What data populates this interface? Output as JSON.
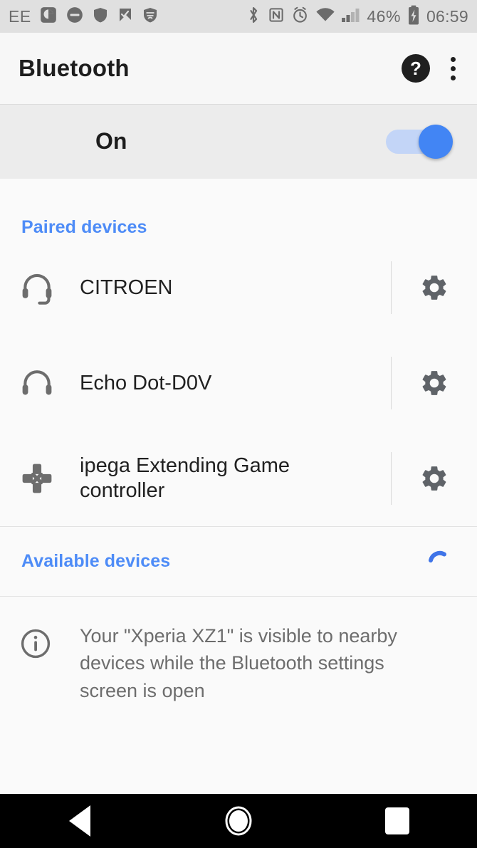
{
  "statusbar": {
    "carrier": "EE",
    "battery_percent": "46%",
    "clock": "06:59",
    "icons_left": [
      "sim-card-icon",
      "do-not-disturb-icon",
      "shield-icon",
      "check-flag-icon",
      "shield-waves-icon"
    ],
    "icons_right": [
      "bluetooth-icon",
      "nfc-icon",
      "alarm-icon",
      "wifi-icon",
      "cellular-signal-icon",
      "battery-charging-icon"
    ],
    "signal_bars_filled": 2,
    "signal_bars_total": 4,
    "bg_color": "#e0e0e0",
    "fg_color": "#6b6b6b"
  },
  "actionbar": {
    "title": "Bluetooth",
    "help_label": "?",
    "help_icon": "help-circle-icon",
    "overflow_icon": "overflow-menu-icon"
  },
  "master_switch": {
    "label": "On",
    "enabled": true,
    "track_color": "#c3d5f7",
    "thumb_color": "#4285f4"
  },
  "sections": {
    "paired": {
      "header": "Paired devices",
      "header_color": "#4e8cf7",
      "devices": [
        {
          "name": "CITROEN",
          "icon": "headset-icon",
          "settings_icon": "gear-icon"
        },
        {
          "name": "Echo Dot-D0V",
          "icon": "headphones-icon",
          "settings_icon": "gear-icon"
        },
        {
          "name": "ipega Extending Game controller",
          "icon": "gamepad-dpad-icon",
          "settings_icon": "gear-icon"
        }
      ]
    },
    "available": {
      "header": "Available devices",
      "header_color": "#4e8cf7",
      "scanning": true,
      "spinner_icon": "progress-spinner-icon",
      "spinner_color": "#3f74e8"
    }
  },
  "info": {
    "icon": "info-circle-icon",
    "text": "Your \"Xperia XZ1\" is visible to nearby devices while the Bluetooth settings screen is open"
  },
  "navbar": {
    "back": "back-button",
    "home": "home-button",
    "recents": "recents-button"
  }
}
